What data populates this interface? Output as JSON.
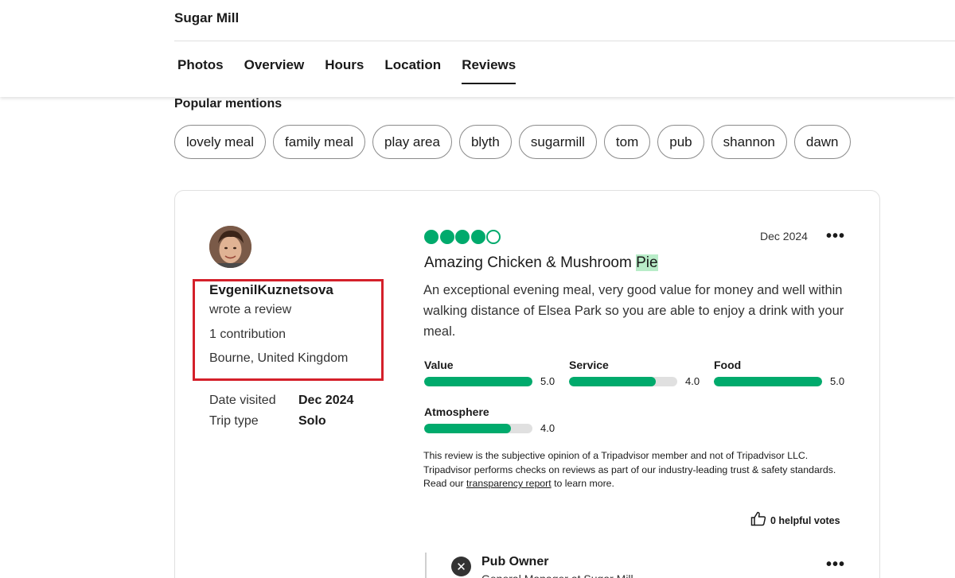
{
  "header": {
    "place_name": "Sugar Mill",
    "tabs": [
      {
        "label": "Photos"
      },
      {
        "label": "Overview"
      },
      {
        "label": "Hours"
      },
      {
        "label": "Location"
      },
      {
        "label": "Reviews",
        "active": true
      }
    ]
  },
  "popular_mentions": {
    "title": "Popular mentions",
    "chips": [
      "lovely meal",
      "family meal",
      "play area",
      "blyth",
      "sugarmill",
      "tom",
      "pub",
      "shannon",
      "dawn"
    ]
  },
  "review": {
    "reviewer": {
      "name": "EvgenilKuznetsova",
      "action": "wrote a review",
      "contributions": "1 contribution",
      "location": "Bourne, United Kingdom"
    },
    "date_visited_label": "Date visited",
    "date_visited": "Dec 2024",
    "trip_type_label": "Trip type",
    "trip_type": "Solo",
    "rating": 4,
    "rating_max": 5,
    "date": "Dec 2024",
    "title_main": "Amazing Chicken & Mushroom ",
    "title_highlight": "Pie",
    "body": "An exceptional evening meal, very good value for money and well within walking distance of Elsea Park so you are able to enjoy a drink with your meal.",
    "sub_ratings": [
      {
        "label": "Value",
        "score": "5.0",
        "value": 5.0
      },
      {
        "label": "Service",
        "score": "4.0",
        "value": 4.0
      },
      {
        "label": "Food",
        "score": "5.0",
        "value": 5.0
      },
      {
        "label": "Atmosphere",
        "score": "4.0",
        "value": 4.0
      }
    ],
    "disclaimer_before": "This review is the subjective opinion of a Tripadvisor member and not of Tripadvisor LLC. Tripadvisor performs checks on reviews as part of our industry-leading trust & safety standards. Read our ",
    "disclaimer_link": "transparency report",
    "disclaimer_after": " to learn more.",
    "helpful_votes": "0 helpful votes",
    "owner_response": {
      "name": "Pub Owner",
      "role": "General Manager at Sugar Mill"
    }
  },
  "colors": {
    "accent_green": "#00aa6c",
    "highlight_red": "#d4202a",
    "title_highlight": "#b8ecc8"
  },
  "icons": {
    "more": "more-dots-icon",
    "helpful": "thumbs-up-icon",
    "owner": "owner-avatar-icon"
  }
}
